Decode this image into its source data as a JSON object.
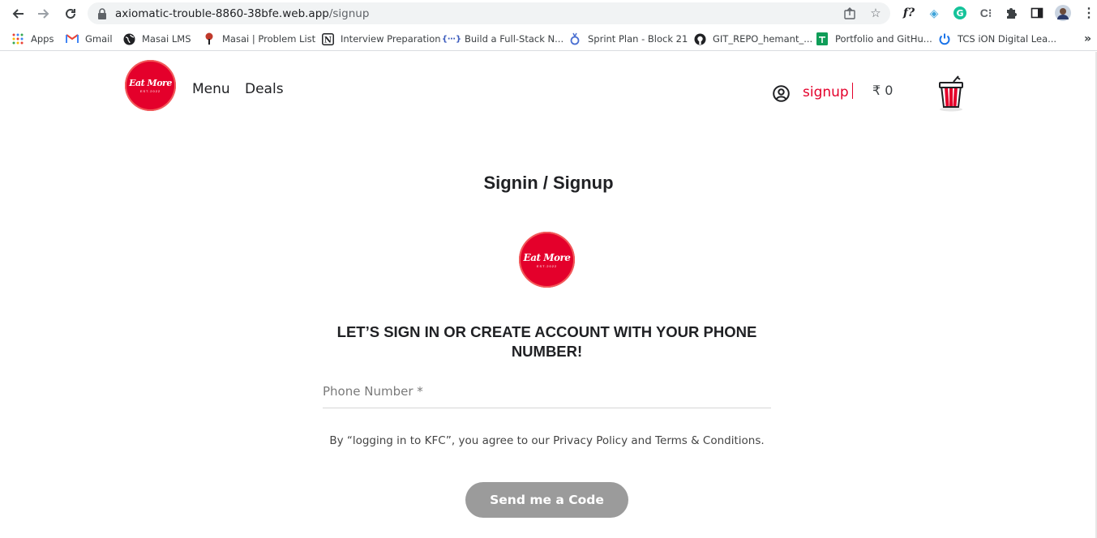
{
  "browser": {
    "url_host": "axiomatic-trouble-8860-38bfe.web.app",
    "url_path": "/signup",
    "bookmarks": [
      {
        "label": "Apps",
        "icon": "apps-grid-icon"
      },
      {
        "label": "Gmail",
        "icon": "gmail-icon"
      },
      {
        "label": "Masai LMS",
        "icon": "globe-icon"
      },
      {
        "label": "Masai | Problem List",
        "icon": "masai-icon"
      },
      {
        "label": "Interview Preparation",
        "icon": "notion-icon"
      },
      {
        "label": "Build a Full-Stack N...",
        "icon": "code-icon"
      },
      {
        "label": "Sprint Plan - Block 21",
        "icon": "sprint-icon"
      },
      {
        "label": "GIT_REPO_hemant_...",
        "icon": "github-icon"
      },
      {
        "label": "Portfolio and GitHu...",
        "icon": "sheets-icon"
      },
      {
        "label": "TCS iON Digital Lea...",
        "icon": "power-icon"
      }
    ],
    "more_bookmarks": "»"
  },
  "header": {
    "logo_text": "Eat More",
    "logo_est": "EST.2022",
    "nav": [
      "Menu",
      "Deals"
    ],
    "signup": "signup",
    "cart_total": "₹ 0"
  },
  "main": {
    "title": "Signin / Signup",
    "heading_line1": "LET’S SIGN IN OR CREATE ACCOUNT WITH YOUR PHONE",
    "heading_line2": "NUMBER!",
    "phone_placeholder": "Phone Number *",
    "terms": "By “logging in to KFC”, you agree to our Privacy Policy and Terms & Conditions.",
    "send_button": "Send me a Code"
  },
  "colors": {
    "brand_red": "#e4002b",
    "button_disabled": "#9b9b9b"
  }
}
